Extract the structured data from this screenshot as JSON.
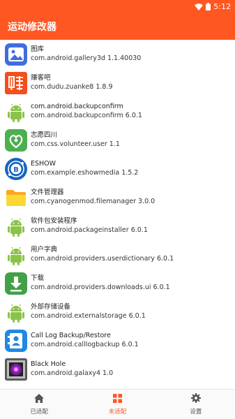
{
  "status_bar": {
    "time": "5:12"
  },
  "app_bar": {
    "title": "运动修改器"
  },
  "apps": [
    {
      "name": "图库",
      "package": "com.android.gallery3d 1.1.40030",
      "icon": "gallery-icon"
    },
    {
      "name": "赚客吧",
      "package": "com.dudu.zuanke8 1.8.9",
      "icon": "zuanke-icon"
    },
    {
      "name": "com.android.backupconfirm",
      "package": "com.android.backupconfirm 6.0.1",
      "icon": "android-icon"
    },
    {
      "name": "志愿四川",
      "package": "com.css.volunteer.user 1.1",
      "icon": "volunteer-icon"
    },
    {
      "name": "ESHOW",
      "package": "com.example.eshowmedia 1.5.2",
      "icon": "eshow-icon"
    },
    {
      "name": "文件管理器",
      "package": "com.cyanogenmod.filemanager 3.0.0",
      "icon": "folder-icon"
    },
    {
      "name": "软件包安装程序",
      "package": "com.android.packageinstaller 6.0.1",
      "icon": "android-icon"
    },
    {
      "name": "用户字典",
      "package": "com.android.providers.userdictionary 6.0.1",
      "icon": "android-icon"
    },
    {
      "name": "下载",
      "package": "com.android.providers.downloads.ui 6.0.1",
      "icon": "download-icon"
    },
    {
      "name": "外部存储设备",
      "package": "com.android.externalstorage 6.0.1",
      "icon": "android-icon"
    },
    {
      "name": "Call Log Backup/Restore",
      "package": "com.android.calllogbackup 6.0.1",
      "icon": "calllog-icon"
    },
    {
      "name": "Black Hole",
      "package": "com.android.galaxy4 1.0",
      "icon": "blackhole-icon"
    }
  ],
  "bottom_nav": [
    {
      "label": "已适配",
      "icon": "home-icon",
      "active": false
    },
    {
      "label": "未适配",
      "icon": "grid-icon",
      "active": true
    },
    {
      "label": "设置",
      "icon": "gear-icon",
      "active": false
    }
  ],
  "colors": {
    "accent": "#ff5722",
    "android_green": "#8bc34a"
  }
}
